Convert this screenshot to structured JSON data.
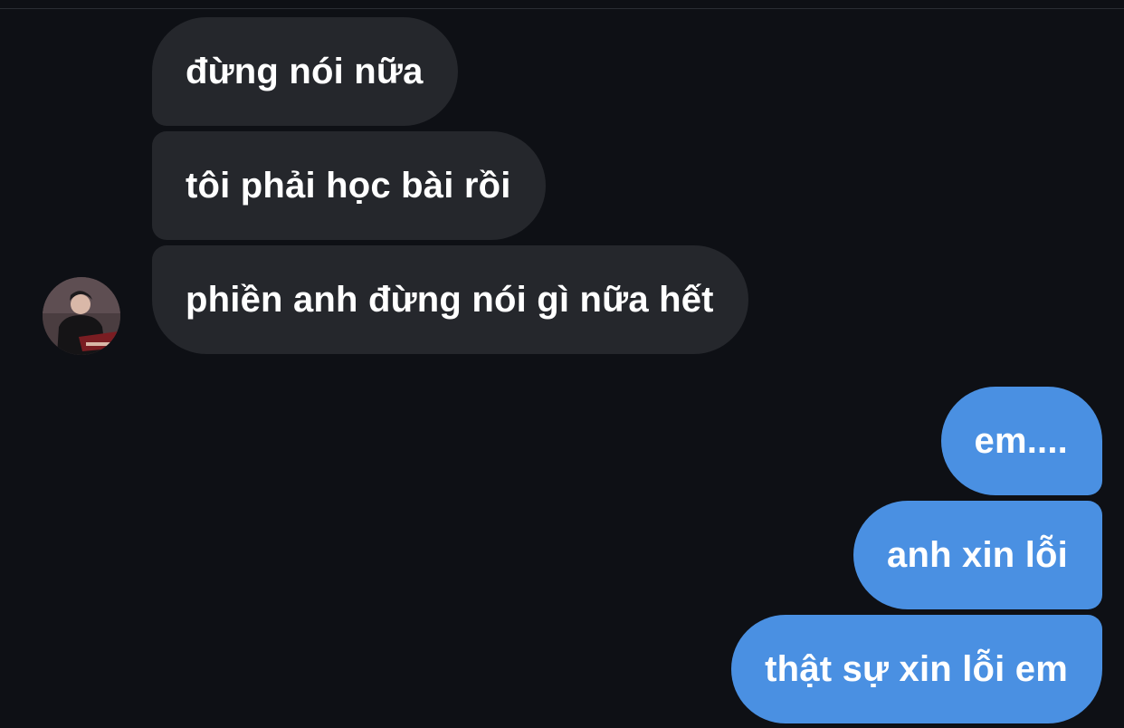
{
  "conversation": {
    "incoming_messages": [
      {
        "text": "đừng nói nữa"
      },
      {
        "text": "tôi phải học bài rồi"
      },
      {
        "text": "phiền anh đừng nói gì nữa hết"
      }
    ],
    "outgoing_messages": [
      {
        "text": "em...."
      },
      {
        "text": "anh xin lỗi"
      },
      {
        "text": "thật sự xin lỗi em"
      }
    ]
  },
  "colors": {
    "background": "#0e1015",
    "incoming_bubble": "#25272c",
    "outgoing_bubble": "#4a90e2",
    "text": "#ffffff"
  },
  "icons": {
    "contact_avatar": "avatar-photo-person-with-guitar"
  }
}
